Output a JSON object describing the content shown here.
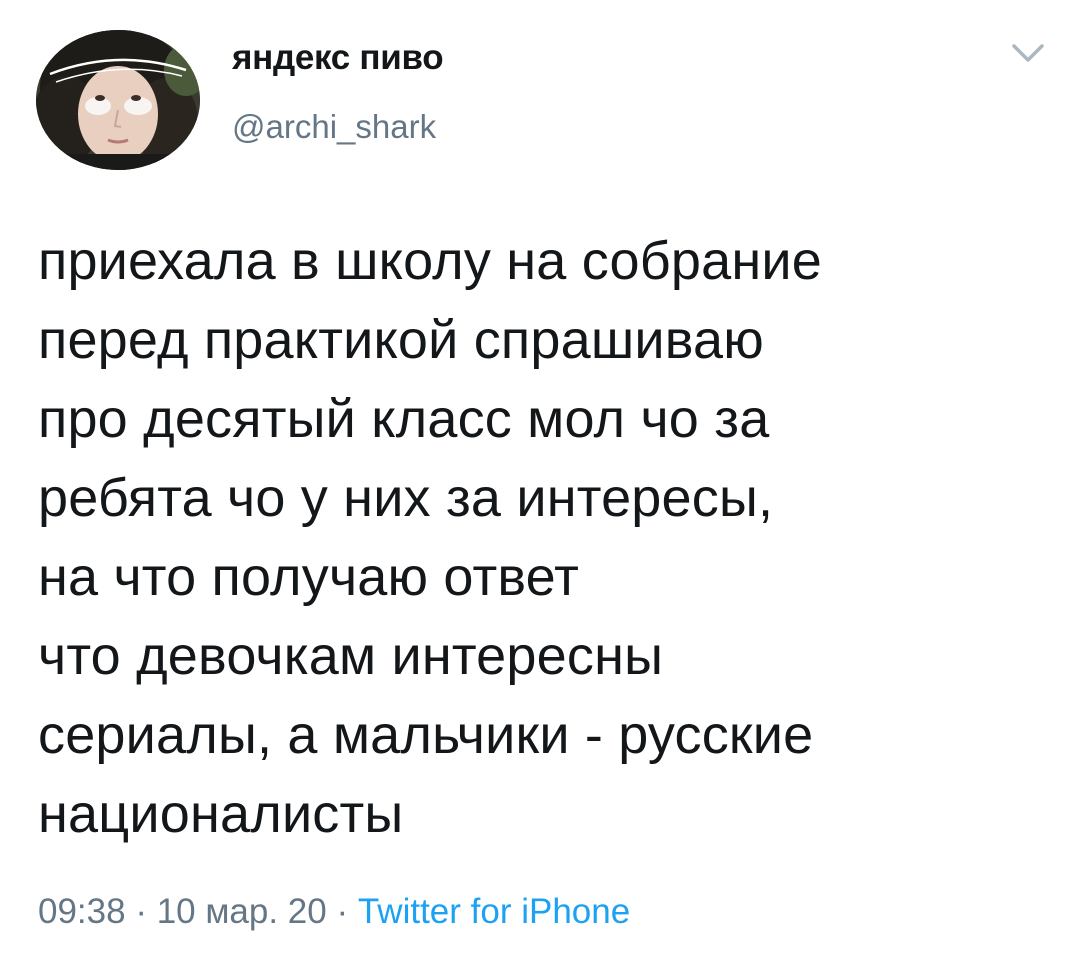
{
  "author": {
    "display_name": "яндекс пиво",
    "handle": "@archi_shark",
    "avatar_icon": "user-avatar-photo"
  },
  "menu": {
    "icon": "chevron-down-icon"
  },
  "tweet": {
    "lines": [
      "приехала в школу на собрание",
      "перед практикой спрашиваю",
      "про десятый класс мол чо за",
      "ребята чо у них за интересы,",
      "на что получаю ответ",
      "что девочкам интересны",
      "сериалы, а мальчики - русские",
      "националисты"
    ]
  },
  "meta": {
    "time": "09:38",
    "separator": " · ",
    "date": "10 мар. 20",
    "source": "Twitter for iPhone"
  },
  "colors": {
    "text": "#14171a",
    "secondary": "#657786",
    "link": "#1da1f2"
  }
}
